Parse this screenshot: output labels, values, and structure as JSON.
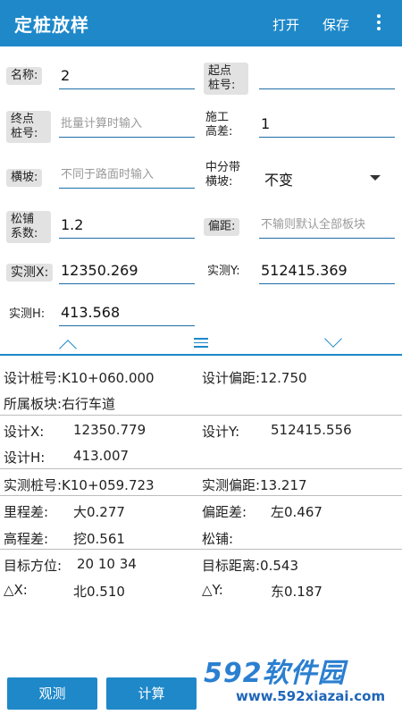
{
  "appbar": {
    "title": "定桩放样",
    "open_label": "打开",
    "save_label": "保存"
  },
  "form": {
    "name_label": "名称:",
    "name_value": "2",
    "start_label": "起点\n桩号:",
    "start_value": "",
    "end_label": "终点\n桩号:",
    "end_placeholder": "批量计算时输入",
    "const_label": "施工\n高差:",
    "const_value": "1",
    "slope_label": "横坡:",
    "slope_placeholder": "不同于路面时输入",
    "median_label": "中分带\n横坡:",
    "median_value": "不变",
    "loose_label": "松铺\n系数:",
    "loose_value": "1.2",
    "offset_label": "偏距:",
    "offset_placeholder": "不输则默认全部板块",
    "mx_label": "实测X:",
    "mx_value": "12350.269",
    "my_label": "实测Y:",
    "my_value": "512415.369",
    "mh_label": "实测H:",
    "mh_value": "413.568"
  },
  "results": {
    "design_station": "设计桩号:K10+060.000",
    "design_offset": "设计偏距:12.750",
    "block": "所属板块:右行车道",
    "dx_label": "设计X:",
    "dx_value": "12350.779",
    "dy_label": "设计Y:",
    "dy_value": "512415.556",
    "dh_label": "设计H:",
    "dh_value": "413.007",
    "meas_station": "实测桩号:K10+059.723",
    "meas_offset": "实测偏距:13.217",
    "chain_diff_label": "里程差:",
    "chain_diff_value": "大0.277",
    "offset_diff_label": "偏距差:",
    "offset_diff_value": "左0.467",
    "elev_diff_label": "高程差:",
    "elev_diff_value": "挖0.561",
    "loose_label": "松铺:",
    "bearing_label": "目标方位:",
    "bearing_value": "20 10 34",
    "distance": "目标距离:0.543",
    "delta_x_label": "△X:",
    "delta_x_value": "北0.510",
    "delta_y_label": "△Y:",
    "delta_y_value": "东0.187"
  },
  "bottom": {
    "observe_label": "观测",
    "compute_label": "计算"
  },
  "watermark": {
    "main": "592软件园",
    "sub": "www.592xiazai.com"
  }
}
